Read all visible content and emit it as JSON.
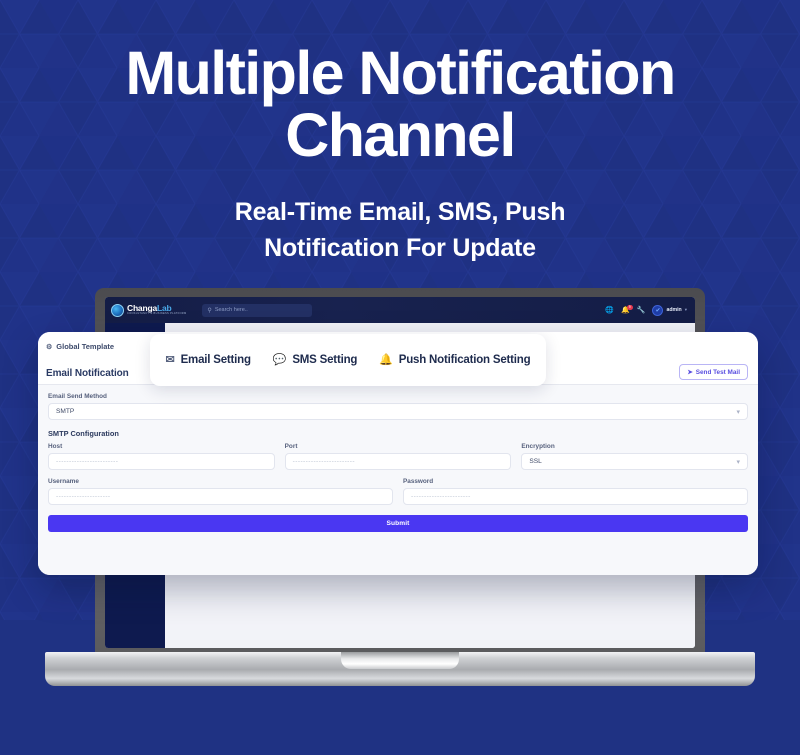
{
  "hero": {
    "title_line1": "Multiple Notification",
    "title_line2": "Channel",
    "subtitle_line1": "Real-Time Email, SMS, Push",
    "subtitle_line2": "Notification For Update",
    "background_color": "#1f3283",
    "title_color": "#ffffff"
  },
  "app": {
    "brand": {
      "name_primary": "Changa",
      "name_accent": "Lab",
      "tagline": "CONSULTANCY & BUSINESS PLATFORM",
      "logo_icon": "globe-logo-icon"
    },
    "search": {
      "placeholder": "Search here..",
      "icon": "search-icon"
    },
    "header_icons": [
      {
        "name": "language-globe-icon",
        "glyph": "◑"
      },
      {
        "name": "notification-bell-icon",
        "glyph": "⬤",
        "badge": "9"
      },
      {
        "name": "wrench-settings-icon",
        "glyph": "⚒"
      }
    ],
    "user": {
      "name": "admin",
      "avatar_icon": "check-avatar-icon",
      "caret_icon": "chevron-down-icon"
    }
  },
  "modal": {
    "breadcrumb_tab": {
      "label": "Global Template",
      "icon": "gear-icon"
    },
    "heading": "Email Notification",
    "tabs": [
      {
        "label": "Email Setting",
        "icon": "envelope-icon",
        "active": true
      },
      {
        "label": "SMS Setting",
        "icon": "chat-bubble-icon",
        "active": false
      },
      {
        "label": "Push Notification Setting",
        "icon": "bell-icon",
        "active": false
      }
    ],
    "test_mail_button": {
      "label": "Send Test Mail",
      "icon": "send-plane-icon",
      "color": "#5a4fe0"
    },
    "form": {
      "send_method": {
        "label": "Email Send Method",
        "value": "SMTP",
        "caret_icon": "chevron-down-icon"
      },
      "section_label": "SMTP Configuration",
      "host": {
        "label": "Host",
        "placeholder": "------------------------"
      },
      "port": {
        "label": "Port",
        "placeholder": "------------------------"
      },
      "encryption": {
        "label": "Encryption",
        "value": "SSL",
        "caret_icon": "chevron-down-icon"
      },
      "username": {
        "label": "Username",
        "placeholder": "---------------------"
      },
      "password": {
        "label": "Password",
        "placeholder": "-----------------------"
      },
      "submit": {
        "label": "Submit",
        "color": "#4a37f2"
      }
    }
  }
}
